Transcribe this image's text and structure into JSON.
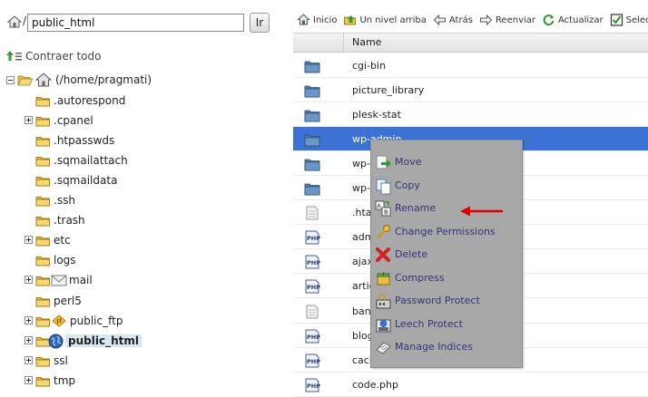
{
  "left_pane": {
    "path_value": "public_html",
    "path_slash": "/",
    "go_button": "Ir",
    "collapse_label": "Contraer todo",
    "root_label": "(/home/pragmati)",
    "tree": [
      {
        "label": ".autorespond",
        "expand": "none",
        "icon": "folder-icon"
      },
      {
        "label": ".cpanel",
        "expand": "plus",
        "icon": "folder-icon"
      },
      {
        "label": ".htpasswds",
        "expand": "none",
        "icon": "folder-icon"
      },
      {
        "label": ".sqmailattach",
        "expand": "none",
        "icon": "folder-icon"
      },
      {
        "label": ".sqmaildata",
        "expand": "none",
        "icon": "folder-icon"
      },
      {
        "label": ".ssh",
        "expand": "none",
        "icon": "folder-icon"
      },
      {
        "label": ".trash",
        "expand": "none",
        "icon": "folder-icon"
      },
      {
        "label": "etc",
        "expand": "plus",
        "icon": "folder-icon"
      },
      {
        "label": "logs",
        "expand": "none",
        "icon": "folder-icon"
      },
      {
        "label": "mail",
        "expand": "plus",
        "icon": "mail-folder-icon"
      },
      {
        "label": "perl5",
        "expand": "none",
        "icon": "folder-icon"
      },
      {
        "label": "public_ftp",
        "expand": "plus",
        "icon": "ftp-folder-icon"
      },
      {
        "label": "public_html",
        "expand": "plus",
        "icon": "globe-folder-icon",
        "selected": true
      },
      {
        "label": "ssl",
        "expand": "plus",
        "icon": "folder-icon"
      },
      {
        "label": "tmp",
        "expand": "plus",
        "icon": "folder-icon"
      }
    ]
  },
  "toolbar": {
    "items": [
      {
        "label": "Inicio",
        "icon": "home-icon"
      },
      {
        "label": "Un nivel arriba",
        "icon": "up-level-icon"
      },
      {
        "label": "Atrás",
        "icon": "back-arrow-icon"
      },
      {
        "label": "Reenviar",
        "icon": "forward-arrow-icon"
      },
      {
        "label": "Actualizar",
        "icon": "refresh-icon"
      },
      {
        "label": "Selec",
        "icon": "checkbox-icon"
      }
    ]
  },
  "table": {
    "header_name": "Name",
    "rows": [
      {
        "name": "cgi-bin",
        "type": "folder"
      },
      {
        "name": "picture_library",
        "type": "folder"
      },
      {
        "name": "plesk-stat",
        "type": "folder"
      },
      {
        "name": "wp-admin",
        "type": "folder",
        "selected": true
      },
      {
        "name": "wp-c",
        "type": "folder"
      },
      {
        "name": "wp-i",
        "type": "folder"
      },
      {
        "name": ".htac",
        "type": "file"
      },
      {
        "name": "adm",
        "type": "php"
      },
      {
        "name": "ajax",
        "type": "php"
      },
      {
        "name": "artic",
        "type": "php"
      },
      {
        "name": "bann",
        "type": "file"
      },
      {
        "name": "blog",
        "type": "php"
      },
      {
        "name": "cach",
        "type": "php"
      },
      {
        "name": "code.php",
        "type": "php"
      }
    ]
  },
  "context_menu": {
    "items": [
      {
        "label": "Move",
        "icon": "move-icon"
      },
      {
        "label": "Copy",
        "icon": "copy-icon"
      },
      {
        "label": "Rename",
        "icon": "rename-icon"
      },
      {
        "label": "Change Permissions",
        "icon": "key-icon"
      },
      {
        "label": "Delete",
        "icon": "delete-x-icon"
      },
      {
        "label": "Compress",
        "icon": "compress-icon"
      },
      {
        "label": "Password Protect",
        "icon": "lock-icon"
      },
      {
        "label": "Leech Protect",
        "icon": "leech-protect-icon"
      },
      {
        "label": "Manage Indices",
        "icon": "indices-icon"
      }
    ]
  },
  "colors": {
    "selection": "#3c72d6",
    "menu_bg": "#a8a8a8",
    "menu_text": "#33337a",
    "arrow": "#e00000"
  }
}
